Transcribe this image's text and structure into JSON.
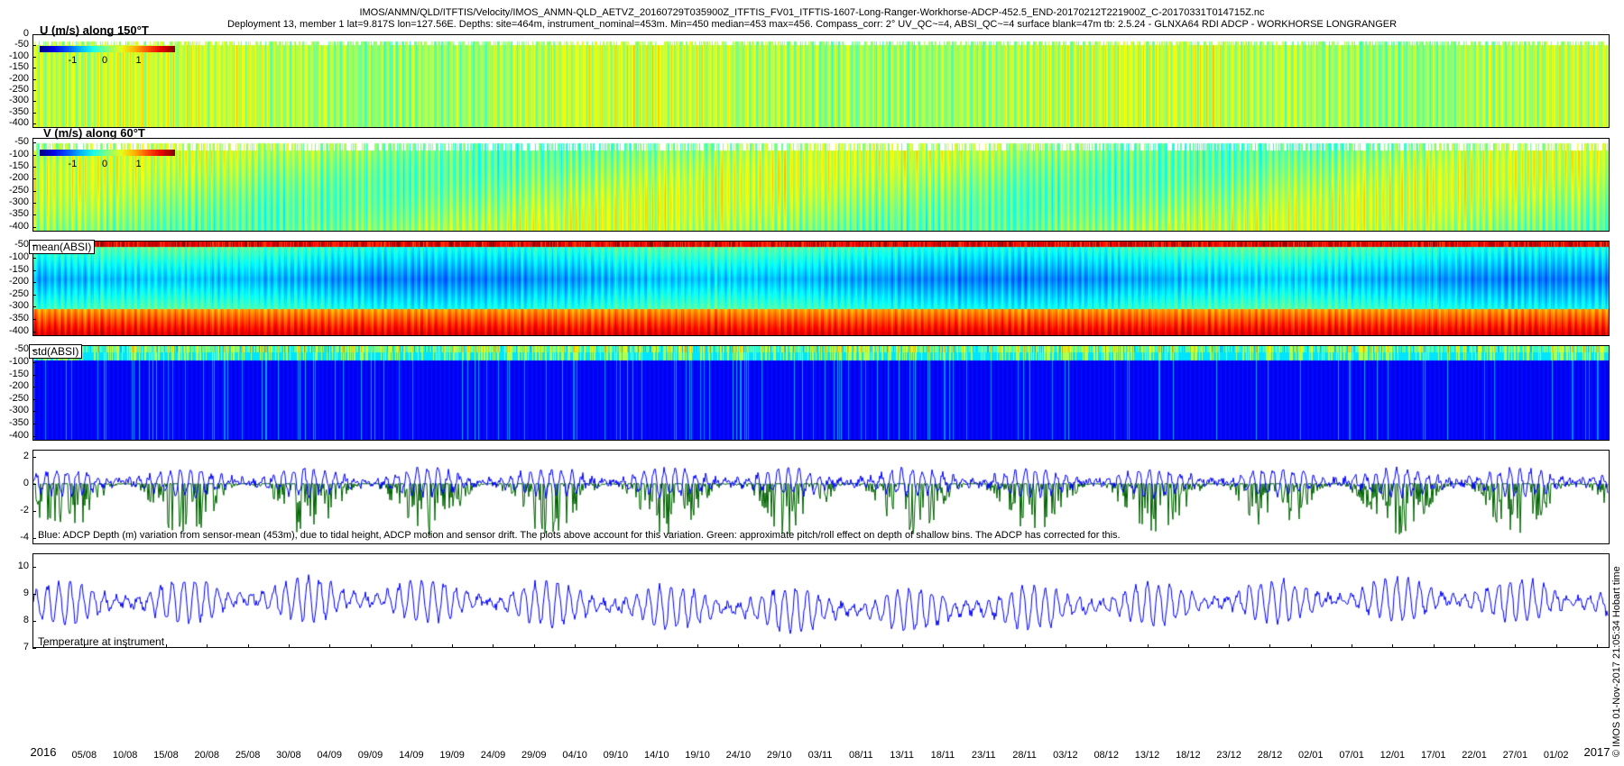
{
  "title": {
    "line1": "IMOS/ANMN/QLD/ITFTIS/Velocity/IMOS_ANMN-QLD_AETVZ_20160729T035900Z_ITFTIS_FV01_ITFTIS-1607-Long-Ranger-Workhorse-ADCP-452.5_END-20170212T221900Z_C-20170331T014715Z.nc",
    "line2": "Deployment 13, member 1 lat=9.817S lon=127.56E. Depths: site=464m, instrument_nominal=453m. Min=450 median=453 max=456. Compass_corr: 2° UV_QC~=4, ABSI_QC~=4 surface blank=47m tb: 2.5.24 - GLNXA64 RDI ADCP - WORKHORSE LONGRANGER"
  },
  "panels": {
    "u": {
      "label": "U (m/s) along 150°T",
      "colorbar_ticks": [
        "-1",
        "0",
        "1"
      ],
      "yticks": [
        "0",
        "-50",
        "-100",
        "-150",
        "-200",
        "-250",
        "-300",
        "-350",
        "-400"
      ]
    },
    "v": {
      "label": "V (m/s) along 60°T",
      "colorbar_ticks": [
        "-1",
        "0",
        "1"
      ],
      "yticks": [
        "-50",
        "-100",
        "-150",
        "-200",
        "-250",
        "-300",
        "-350",
        "-400"
      ]
    },
    "mean": {
      "label": "mean(ABSI)",
      "yticks": [
        "-50",
        "-100",
        "-150",
        "-200",
        "-250",
        "-300",
        "-350",
        "-400"
      ]
    },
    "std": {
      "label": "std(ABSI)",
      "yticks": [
        "-50",
        "-100",
        "-150",
        "-200",
        "-250",
        "-300",
        "-350",
        "-400"
      ]
    },
    "depth": {
      "yticks": [
        "2",
        "0",
        "-2",
        "-4"
      ],
      "note": "Blue: ADCP Depth (m) variation from sensor-mean (453m), due to tidal height, ADCP motion and sensor drift. The plots above account for this variation. Green: approximate pitch/roll effect on depth of shallow bins. The ADCP has corrected for this."
    },
    "temp": {
      "label": "Temperature at instrument",
      "yticks": [
        "10",
        "9",
        "8",
        "7"
      ]
    }
  },
  "xaxis": {
    "labels": [
      "2016",
      "05/08",
      "10/08",
      "15/08",
      "20/08",
      "25/08",
      "30/08",
      "04/09",
      "09/09",
      "14/09",
      "19/09",
      "24/09",
      "29/09",
      "04/10",
      "09/10",
      "14/10",
      "19/10",
      "24/10",
      "29/10",
      "03/11",
      "08/11",
      "13/11",
      "18/11",
      "23/11",
      "28/11",
      "03/12",
      "08/12",
      "13/12",
      "18/12",
      "23/12",
      "28/12",
      "02/01",
      "07/01",
      "12/01",
      "17/01",
      "22/01",
      "27/01",
      "01/02",
      "2017"
    ]
  },
  "copyright": "© IMOS 01-Nov-2017 21:05:34 Hobart time",
  "chart_data": [
    {
      "type": "heatmap",
      "title": "U (m/s) along 150°T",
      "ylim": [
        -420,
        0
      ],
      "colorbar_range": [
        -1.5,
        1.5
      ],
      "colormap": "jet",
      "x": [
        "2016-07-29",
        "2017-02-12"
      ],
      "description_values": "velocities mostly near 0 to 0.5 m/s"
    },
    {
      "type": "heatmap",
      "title": "V (m/s) along 60°T",
      "ylim": [
        -420,
        -30
      ],
      "colorbar_range": [
        -1.5,
        1.5
      ],
      "colormap": "jet",
      "x": [
        "2016-07-29",
        "2017-02-12"
      ]
    },
    {
      "type": "heatmap",
      "title": "mean(ABSI)",
      "ylim": [
        -420,
        -30
      ],
      "colormap": "jet",
      "x": [
        "2016-07-29",
        "2017-02-12"
      ]
    },
    {
      "type": "heatmap",
      "title": "std(ABSI)",
      "ylim": [
        -420,
        -30
      ],
      "colormap": "jet",
      "x": [
        "2016-07-29",
        "2017-02-12"
      ]
    },
    {
      "type": "line",
      "ylim": [
        -4.5,
        2.5
      ],
      "series": [
        {
          "color": "#0000ff"
        },
        {
          "color": "#006400"
        }
      ],
      "x": [
        "2016-07-29",
        "2017-02-12"
      ]
    },
    {
      "type": "line",
      "title": "Temperature at instrument",
      "ylim": [
        7,
        10.5
      ],
      "series": [
        {
          "color": "#0000ff"
        }
      ],
      "x": [
        "2016-07-29",
        "2017-02-12"
      ]
    }
  ]
}
